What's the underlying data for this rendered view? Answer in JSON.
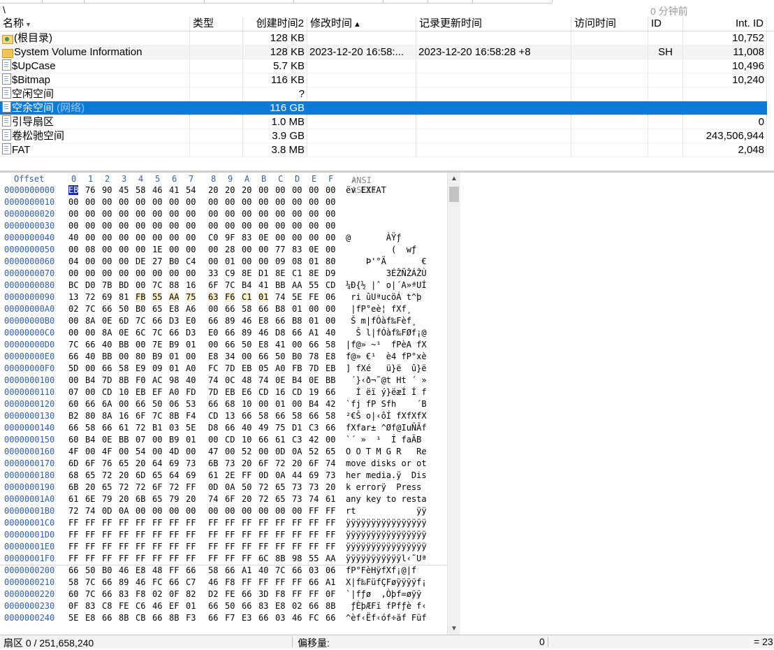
{
  "path": "\\",
  "last_update": "0 分钟前",
  "file_list": {
    "columns": [
      {
        "key": "name",
        "label": "名称"
      },
      {
        "key": "type",
        "label": "类型"
      },
      {
        "key": "created",
        "label": "创建时间2"
      },
      {
        "key": "modified",
        "label": "修改时间"
      },
      {
        "key": "record_updated",
        "label": "记录更新时间"
      },
      {
        "key": "accessed",
        "label": "访问时间"
      },
      {
        "key": "id",
        "label": "ID"
      },
      {
        "key": "int_id",
        "label": "Int. ID"
      }
    ],
    "rows": [
      {
        "icon": "root-folder-icon",
        "name": "(根目录)",
        "type": "",
        "created": "128 KB",
        "modified": "",
        "record_updated": "",
        "accessed": "",
        "id": "",
        "int_id": "10,752"
      },
      {
        "icon": "folder-icon",
        "name": "System Volume Information",
        "type": "",
        "created": "128 KB",
        "modified": "2023-12-20  16:58:...",
        "record_updated": "2023-12-20  16:58:28  +8",
        "accessed": "",
        "id": "SH",
        "int_id": "11,008"
      },
      {
        "icon": "file-icon",
        "name": "$UpCase",
        "type": "",
        "created": "5.7 KB",
        "modified": "",
        "record_updated": "",
        "accessed": "",
        "id": "",
        "int_id": "10,496"
      },
      {
        "icon": "file-icon",
        "name": "$Bitmap",
        "type": "",
        "created": "116 KB",
        "modified": "",
        "record_updated": "",
        "accessed": "",
        "id": "",
        "int_id": "10,240"
      },
      {
        "icon": "file-icon",
        "name": "空闲空间",
        "type": "",
        "created": "?",
        "modified": "",
        "record_updated": "",
        "accessed": "",
        "id": "",
        "int_id": ""
      },
      {
        "icon": "file-icon",
        "name": "空余空间",
        "name_suffix": " (网络)",
        "type": "",
        "created": "116 GB",
        "modified": "",
        "record_updated": "",
        "accessed": "",
        "id": "",
        "int_id": ""
      },
      {
        "icon": "file-icon",
        "name": "引导扇区",
        "type": "",
        "created": "1.0 MB",
        "modified": "",
        "record_updated": "",
        "accessed": "",
        "id": "",
        "int_id": "0"
      },
      {
        "icon": "file-icon",
        "name": "卷松驰空间",
        "type": "",
        "created": "3.9 GB",
        "modified": "",
        "record_updated": "",
        "accessed": "",
        "id": "",
        "int_id": "243,506,944"
      },
      {
        "icon": "file-icon",
        "name": "FAT",
        "type": "",
        "created": "3.8 MB",
        "modified": "",
        "record_updated": "",
        "accessed": "",
        "id": "",
        "int_id": "2,048"
      }
    ],
    "selected_row": 5
  },
  "hex": {
    "offset_label": "Offset",
    "col_labels": [
      "0",
      "1",
      "2",
      "3",
      "4",
      "5",
      "6",
      "7",
      "8",
      "9",
      "A",
      "B",
      "C",
      "D",
      "E",
      "F"
    ],
    "ascii_header": "ANSI ASCII",
    "rows": [
      {
        "off": "0000000000",
        "b": [
          "EB",
          "76",
          "90",
          "45",
          "58",
          "46",
          "41",
          "54",
          "20",
          "20",
          "20",
          "00",
          "00",
          "00",
          "00",
          "00"
        ],
        "a": "ëv EXFAT"
      },
      {
        "off": "0000000010",
        "b": [
          "00",
          "00",
          "00",
          "00",
          "00",
          "00",
          "00",
          "00",
          "00",
          "00",
          "00",
          "00",
          "00",
          "00",
          "00",
          "00"
        ],
        "a": ""
      },
      {
        "off": "0000000020",
        "b": [
          "00",
          "00",
          "00",
          "00",
          "00",
          "00",
          "00",
          "00",
          "00",
          "00",
          "00",
          "00",
          "00",
          "00",
          "00",
          "00"
        ],
        "a": ""
      },
      {
        "off": "0000000030",
        "b": [
          "00",
          "00",
          "00",
          "00",
          "00",
          "00",
          "00",
          "00",
          "00",
          "00",
          "00",
          "00",
          "00",
          "00",
          "00",
          "00"
        ],
        "a": ""
      },
      {
        "off": "0000000040",
        "b": [
          "40",
          "00",
          "00",
          "00",
          "00",
          "00",
          "00",
          "00",
          "C0",
          "9F",
          "83",
          "0E",
          "00",
          "00",
          "00",
          "00"
        ],
        "a": "@       ÀŸƒ"
      },
      {
        "off": "0000000050",
        "b": [
          "00",
          "08",
          "00",
          "00",
          "00",
          "1E",
          "00",
          "00",
          "00",
          "28",
          "00",
          "00",
          "77",
          "83",
          "0E",
          "00"
        ],
        "a": "         (  wƒ"
      },
      {
        "off": "0000000060",
        "b": [
          "04",
          "00",
          "00",
          "00",
          "DE",
          "27",
          "B0",
          "C4",
          "00",
          "01",
          "00",
          "00",
          "09",
          "08",
          "01",
          "80"
        ],
        "a": "    Þ'°Ä       €"
      },
      {
        "off": "0000000070",
        "b": [
          "00",
          "00",
          "00",
          "00",
          "00",
          "00",
          "00",
          "00",
          "33",
          "C9",
          "8E",
          "D1",
          "8E",
          "C1",
          "8E",
          "D9"
        ],
        "a": "        3ÉŽÑŽÁŽÙ"
      },
      {
        "off": "0000000080",
        "b": [
          "BC",
          "D0",
          "7B",
          "BD",
          "00",
          "7C",
          "88",
          "16",
          "6F",
          "7C",
          "B4",
          "41",
          "BB",
          "AA",
          "55",
          "CD"
        ],
        "a": "¼Ð{½ |ˆ o|´A»ªUÍ"
      },
      {
        "off": "0000000090",
        "b": [
          "13",
          "72",
          "69",
          "81",
          "FB",
          "55",
          "AA",
          "75",
          "63",
          "F6",
          "C1",
          "01",
          "74",
          "5E",
          "FE",
          "06"
        ],
        "a": " ri ûUªucöÁ t^þ"
      },
      {
        "off": "00000000A0",
        "b": [
          "02",
          "7C",
          "66",
          "50",
          "B0",
          "65",
          "E8",
          "A6",
          "00",
          "66",
          "58",
          "66",
          "B8",
          "01",
          "00",
          "00"
        ],
        "a": " |fP°eè¦ fXf¸"
      },
      {
        "off": "00000000B0",
        "b": [
          "00",
          "8A",
          "0E",
          "6D",
          "7C",
          "66",
          "D3",
          "E0",
          "66",
          "89",
          "46",
          "E8",
          "66",
          "B8",
          "01",
          "00"
        ],
        "a": " Š m|fÓàf‰Fèf¸"
      },
      {
        "off": "00000000C0",
        "b": [
          "00",
          "00",
          "8A",
          "0E",
          "6C",
          "7C",
          "66",
          "D3",
          "E0",
          "66",
          "89",
          "46",
          "D8",
          "66",
          "A1",
          "40"
        ],
        "a": "  Š l|fÓàf‰FØf¡@"
      },
      {
        "off": "00000000D0",
        "b": [
          "7C",
          "66",
          "40",
          "BB",
          "00",
          "7E",
          "B9",
          "01",
          "00",
          "66",
          "50",
          "E8",
          "41",
          "00",
          "66",
          "58"
        ],
        "a": "|f@» ~¹  fPèA fX"
      },
      {
        "off": "00000000E0",
        "b": [
          "66",
          "40",
          "BB",
          "00",
          "80",
          "B9",
          "01",
          "00",
          "E8",
          "34",
          "00",
          "66",
          "50",
          "B0",
          "78",
          "E8"
        ],
        "a": "f@» €¹  è4 fP°xè"
      },
      {
        "off": "00000000F0",
        "b": [
          "5D",
          "00",
          "66",
          "58",
          "E9",
          "09",
          "01",
          "A0",
          "FC",
          "7D",
          "EB",
          "05",
          "A0",
          "FB",
          "7D",
          "EB"
        ],
        "a": "] fXé   ü}ë  û}ë"
      },
      {
        "off": "0000000100",
        "b": [
          "00",
          "B4",
          "7D",
          "8B",
          "F0",
          "AC",
          "98",
          "40",
          "74",
          "0C",
          "48",
          "74",
          "0E",
          "B4",
          "0E",
          "BB"
        ],
        "a": " ´}‹ð¬˜@t Ht ´ »"
      },
      {
        "off": "0000000110",
        "b": [
          "07",
          "00",
          "CD",
          "10",
          "EB",
          "EF",
          "A0",
          "FD",
          "7D",
          "EB",
          "E6",
          "CD",
          "16",
          "CD",
          "19",
          "66"
        ],
        "a": "  Í ëï ý}ëæÍ Í f"
      },
      {
        "off": "0000000120",
        "b": [
          "60",
          "66",
          "6A",
          "00",
          "66",
          "50",
          "06",
          "53",
          "66",
          "68",
          "10",
          "00",
          "01",
          "00",
          "B4",
          "42"
        ],
        "a": "`fj fP Sfh    ´B"
      },
      {
        "off": "0000000130",
        "b": [
          "B2",
          "80",
          "8A",
          "16",
          "6F",
          "7C",
          "8B",
          "F4",
          "CD",
          "13",
          "66",
          "58",
          "66",
          "58",
          "66",
          "58"
        ],
        "a": "²€Š o|‹ôÍ fXfXfX"
      },
      {
        "off": "0000000140",
        "b": [
          "66",
          "58",
          "66",
          "61",
          "72",
          "B1",
          "03",
          "5E",
          "D8",
          "66",
          "40",
          "49",
          "75",
          "D1",
          "C3",
          "66"
        ],
        "a": "fXfar± ^Øf@IuÑÃf"
      },
      {
        "off": "0000000150",
        "b": [
          "60",
          "B4",
          "0E",
          "BB",
          "07",
          "00",
          "B9",
          "01",
          "00",
          "CD",
          "10",
          "66",
          "61",
          "C3",
          "42",
          "00"
        ],
        "a": "`´ »  ¹  Í faÃB"
      },
      {
        "off": "0000000160",
        "b": [
          "4F",
          "00",
          "4F",
          "00",
          "54",
          "00",
          "4D",
          "00",
          "47",
          "00",
          "52",
          "00",
          "0D",
          "0A",
          "52",
          "65"
        ],
        "a": "O O T M G R   Re"
      },
      {
        "off": "0000000170",
        "b": [
          "6D",
          "6F",
          "76",
          "65",
          "20",
          "64",
          "69",
          "73",
          "6B",
          "73",
          "20",
          "6F",
          "72",
          "20",
          "6F",
          "74"
        ],
        "a": "move disks or ot"
      },
      {
        "off": "0000000180",
        "b": [
          "68",
          "65",
          "72",
          "20",
          "6D",
          "65",
          "64",
          "69",
          "61",
          "2E",
          "FF",
          "0D",
          "0A",
          "44",
          "69",
          "73"
        ],
        "a": "her media.ÿ  Dis"
      },
      {
        "off": "0000000190",
        "b": [
          "6B",
          "20",
          "65",
          "72",
          "72",
          "6F",
          "72",
          "FF",
          "0D",
          "0A",
          "50",
          "72",
          "65",
          "73",
          "73",
          "20"
        ],
        "a": "k errorÿ  Press "
      },
      {
        "off": "00000001A0",
        "b": [
          "61",
          "6E",
          "79",
          "20",
          "6B",
          "65",
          "79",
          "20",
          "74",
          "6F",
          "20",
          "72",
          "65",
          "73",
          "74",
          "61"
        ],
        "a": "any key to resta"
      },
      {
        "off": "00000001B0",
        "b": [
          "72",
          "74",
          "0D",
          "0A",
          "00",
          "00",
          "00",
          "00",
          "00",
          "00",
          "00",
          "00",
          "00",
          "00",
          "FF",
          "FF"
        ],
        "a": "rt            ÿÿ"
      },
      {
        "off": "00000001C0",
        "b": [
          "FF",
          "FF",
          "FF",
          "FF",
          "FF",
          "FF",
          "FF",
          "FF",
          "FF",
          "FF",
          "FF",
          "FF",
          "FF",
          "FF",
          "FF",
          "FF"
        ],
        "a": "ÿÿÿÿÿÿÿÿÿÿÿÿÿÿÿÿ"
      },
      {
        "off": "00000001D0",
        "b": [
          "FF",
          "FF",
          "FF",
          "FF",
          "FF",
          "FF",
          "FF",
          "FF",
          "FF",
          "FF",
          "FF",
          "FF",
          "FF",
          "FF",
          "FF",
          "FF"
        ],
        "a": "ÿÿÿÿÿÿÿÿÿÿÿÿÿÿÿÿ"
      },
      {
        "off": "00000001E0",
        "b": [
          "FF",
          "FF",
          "FF",
          "FF",
          "FF",
          "FF",
          "FF",
          "FF",
          "FF",
          "FF",
          "FF",
          "FF",
          "FF",
          "FF",
          "FF",
          "FF"
        ],
        "a": "ÿÿÿÿÿÿÿÿÿÿÿÿÿÿÿÿ"
      },
      {
        "off": "00000001F0",
        "b": [
          "FF",
          "FF",
          "FF",
          "FF",
          "FF",
          "FF",
          "FF",
          "FF",
          "FF",
          "FF",
          "FF",
          "6C",
          "8B",
          "98",
          "55",
          "AA"
        ],
        "a": "ÿÿÿÿÿÿÿÿÿÿÿl‹˜Uª"
      },
      {
        "off": "0000000200",
        "b": [
          "66",
          "50",
          "B0",
          "46",
          "E8",
          "48",
          "FF",
          "66",
          "58",
          "66",
          "A1",
          "40",
          "7C",
          "66",
          "03",
          "06"
        ],
        "a": "fP°FèHÿfXf¡@|f"
      },
      {
        "off": "0000000210",
        "b": [
          "58",
          "7C",
          "66",
          "89",
          "46",
          "FC",
          "66",
          "C7",
          "46",
          "F8",
          "FF",
          "FF",
          "FF",
          "FF",
          "66",
          "A1"
        ],
        "a": "X|f‰FüfÇFøÿÿÿÿf¡"
      },
      {
        "off": "0000000220",
        "b": [
          "60",
          "7C",
          "66",
          "83",
          "F8",
          "02",
          "0F",
          "82",
          "D2",
          "FE",
          "66",
          "3D",
          "F8",
          "FF",
          "FF",
          "0F"
        ],
        "a": "`|fƒø  ‚Òþf=øÿÿ"
      },
      {
        "off": "0000000230",
        "b": [
          "0F",
          "83",
          "C8",
          "FE",
          "C6",
          "46",
          "EF",
          "01",
          "66",
          "50",
          "66",
          "83",
          "E8",
          "02",
          "66",
          "8B"
        ],
        "a": " ƒÈþÆFï fPfƒè f‹"
      },
      {
        "off": "0000000240",
        "b": [
          "5E",
          "E8",
          "66",
          "8B",
          "CB",
          "66",
          "8B",
          "F3",
          "66",
          "F7",
          "E3",
          "66",
          "03",
          "46",
          "FC",
          "66"
        ],
        "a": "^èf‹Ëf‹óf÷ãf Füf"
      }
    ]
  },
  "status": {
    "sector": "扇区 0 / 251,658,240",
    "offset_label": "偏移量:",
    "offset_value": "0",
    "value_eq": "= 23"
  },
  "colors": {
    "selection": "#0a7bd8",
    "offset_text": "#2f5fb0",
    "cursor_byte": "#1a2ea8",
    "highlight_bytes": "#fdf0c8"
  }
}
